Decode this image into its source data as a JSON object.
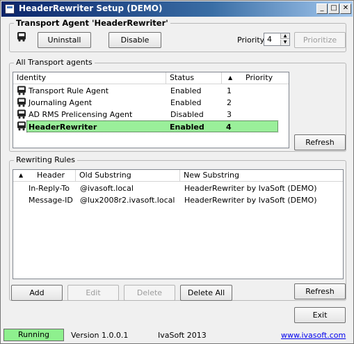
{
  "window": {
    "title": "HeaderRewriter Setup (DEMO)",
    "minimize_glyph": "_",
    "maximize_glyph": "□",
    "close_glyph": "✕"
  },
  "transport_group": {
    "title": "Transport Agent 'HeaderRewriter'",
    "uninstall_label": "Uninstall",
    "disable_label": "Disable",
    "priority_label": "Priority:",
    "priority_value": "4",
    "prioritize_label": "Prioritize"
  },
  "agents_group": {
    "title": "All Transport agents",
    "columns": {
      "identity": "Identity",
      "status": "Status",
      "priority": "Priority"
    },
    "sort_glyph": "▲",
    "rows": [
      {
        "identity": "Transport Rule Agent",
        "status": "Enabled",
        "priority": "1"
      },
      {
        "identity": "Journaling Agent",
        "status": "Enabled",
        "priority": "2"
      },
      {
        "identity": "AD RMS Prelicensing Agent",
        "status": "Disabled",
        "priority": "3"
      },
      {
        "identity": "HeaderRewriter",
        "status": "Enabled",
        "priority": "4"
      }
    ],
    "selected_color": "#9aef9a",
    "refresh_label": "Refresh"
  },
  "rules_group": {
    "title": "Rewriting Rules",
    "columns": {
      "header": "Header",
      "old": "Old Substring",
      "new": "New Substring"
    },
    "sort_glyph": "▲",
    "rows": [
      {
        "header": "In-Reply-To",
        "old": "@ivasoft.local",
        "new": "HeaderRewriter by IvaSoft (DEMO)"
      },
      {
        "header": "Message-ID",
        "old": "@lux2008r2.ivasoft.local",
        "new": "HeaderRewriter by IvaSoft (DEMO)"
      }
    ],
    "add_label": "Add",
    "edit_label": "Edit",
    "delete_label": "Delete",
    "delete_all_label": "Delete All",
    "refresh_label": "Refresh"
  },
  "exit_label": "Exit",
  "status_bar": {
    "state": "Running",
    "state_color": "#8ef08e",
    "version": "Version 1.0.0.1",
    "company": "IvaSoft 2013",
    "link": "www.ivasoft.com"
  },
  "icons": {
    "agent": "bus-icon",
    "app": "app-window-icon"
  }
}
